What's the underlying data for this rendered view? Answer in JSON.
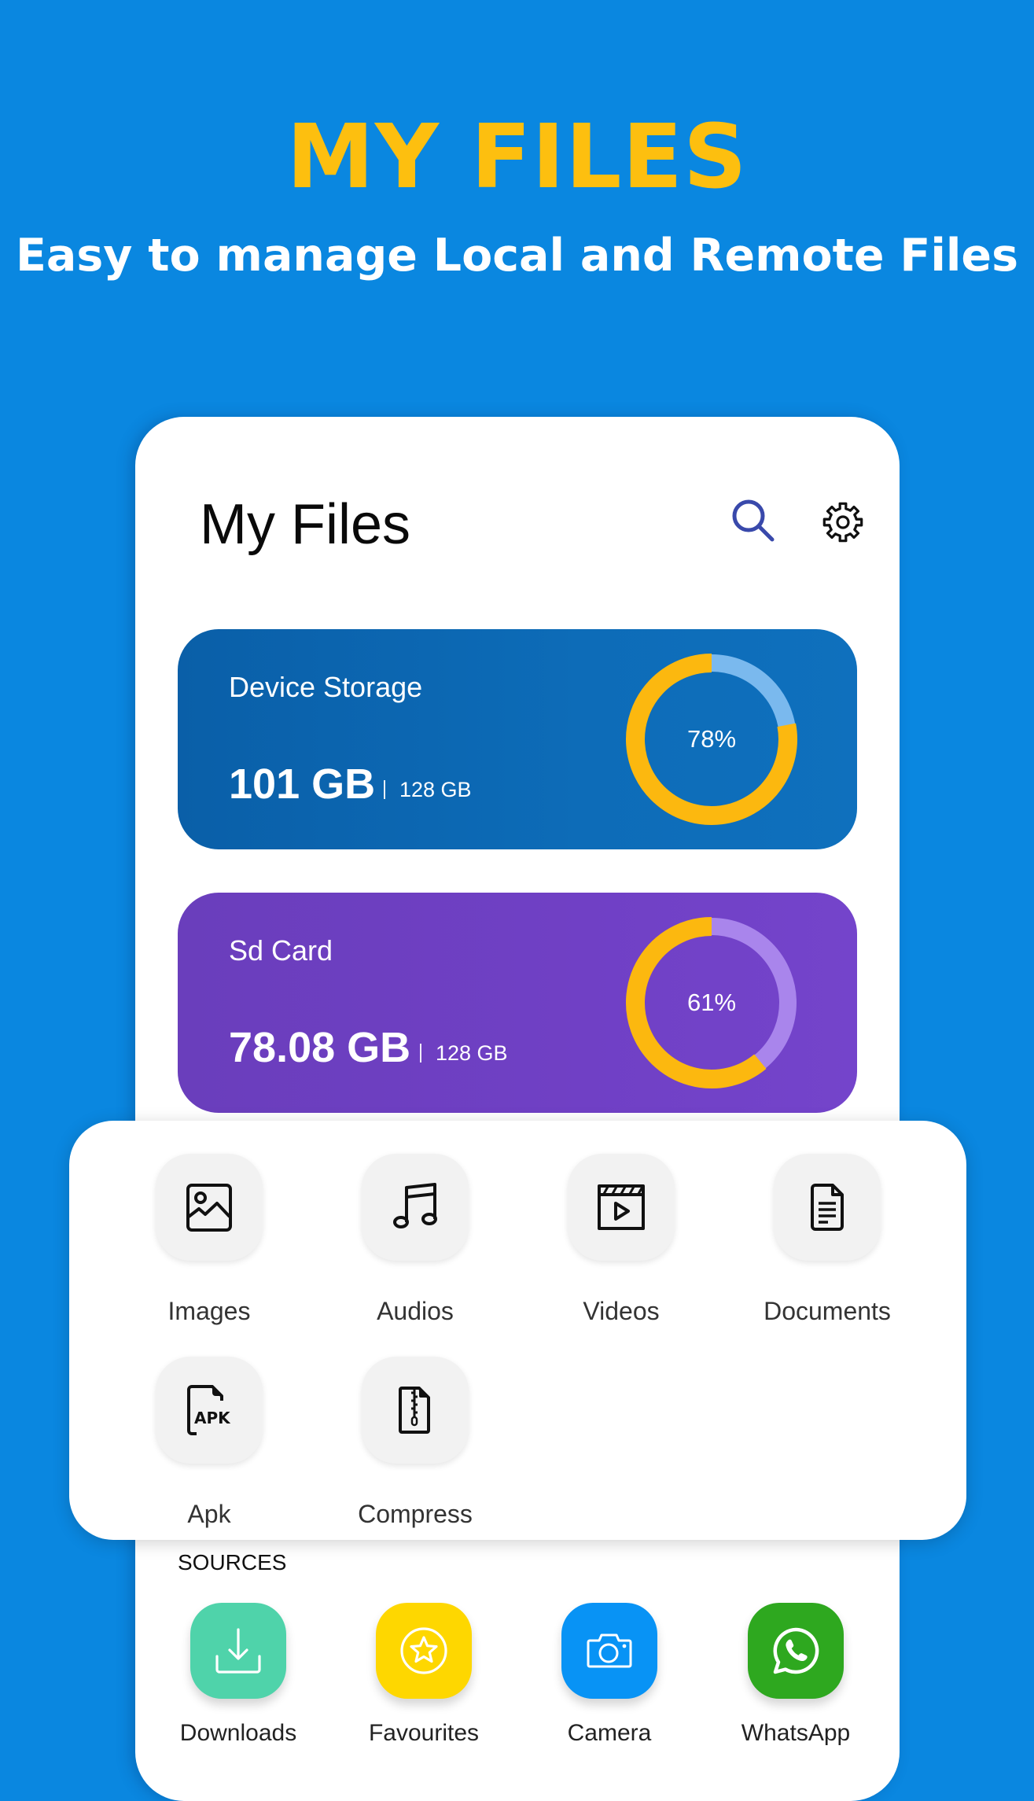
{
  "hero": {
    "title": "MY FILES",
    "subtitle": "Easy to manage Local and Remote Files"
  },
  "app": {
    "title": "My Files",
    "search_icon": "search-icon",
    "settings_icon": "gear-icon",
    "colors": {
      "background": "#0a87e0",
      "hero_title": "#fdbf0f",
      "search_icon": "#3949ab",
      "donut_used": "#fcb80f"
    }
  },
  "storage": [
    {
      "label": "Device Storage",
      "used": "101 GB",
      "total": "128 GB",
      "percent_text": "78%",
      "percent": 78,
      "color": "#0d66b2",
      "remaining_color": "#7ab9ee"
    },
    {
      "label": "Sd Card",
      "used": "78.08 GB",
      "total": "128 GB",
      "percent_text": "61%",
      "percent": 61,
      "color": "#6e42c4",
      "remaining_color": "#a985ec"
    }
  ],
  "categories": [
    {
      "label": "Images",
      "icon": "image-icon"
    },
    {
      "label": "Audios",
      "icon": "music-note-icon"
    },
    {
      "label": "Videos",
      "icon": "video-clapper-icon"
    },
    {
      "label": "Documents",
      "icon": "document-icon"
    },
    {
      "label": "Apk",
      "icon": "apk-file-icon"
    },
    {
      "label": "Compress",
      "icon": "zip-file-icon"
    }
  ],
  "sources": {
    "heading": "SOURCES",
    "items": [
      {
        "label": "Downloads",
        "icon": "download-icon",
        "color": "#4fd3aa"
      },
      {
        "label": "Favourites",
        "icon": "star-icon",
        "color": "#fed700"
      },
      {
        "label": "Camera",
        "icon": "camera-icon",
        "color": "#0893f5"
      },
      {
        "label": "WhatsApp",
        "icon": "whatsapp-icon",
        "color": "#2ea81f"
      }
    ]
  }
}
